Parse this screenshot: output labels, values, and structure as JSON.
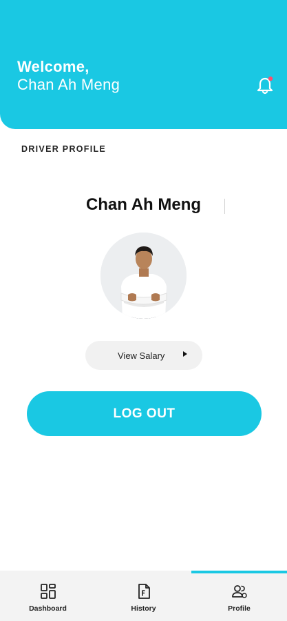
{
  "header": {
    "greeting": "Welcome,",
    "user_name": "Chan Ah Meng",
    "notification_icon": "bell-icon",
    "notification_dot_color": "#ff4d6d",
    "accent_color": "#1ac8e3"
  },
  "profile": {
    "section_title": "DRIVER PROFILE",
    "driver_name": "Chan Ah Meng",
    "view_salary_label": "View Salary",
    "logout_label": "LOG OUT"
  },
  "bottom_nav": {
    "active_tab": "Profile",
    "items": [
      {
        "label": "Dashboard",
        "icon": "dashboard-icon"
      },
      {
        "label": "History",
        "icon": "document-icon"
      },
      {
        "label": "Profile",
        "icon": "users-icon"
      }
    ]
  }
}
